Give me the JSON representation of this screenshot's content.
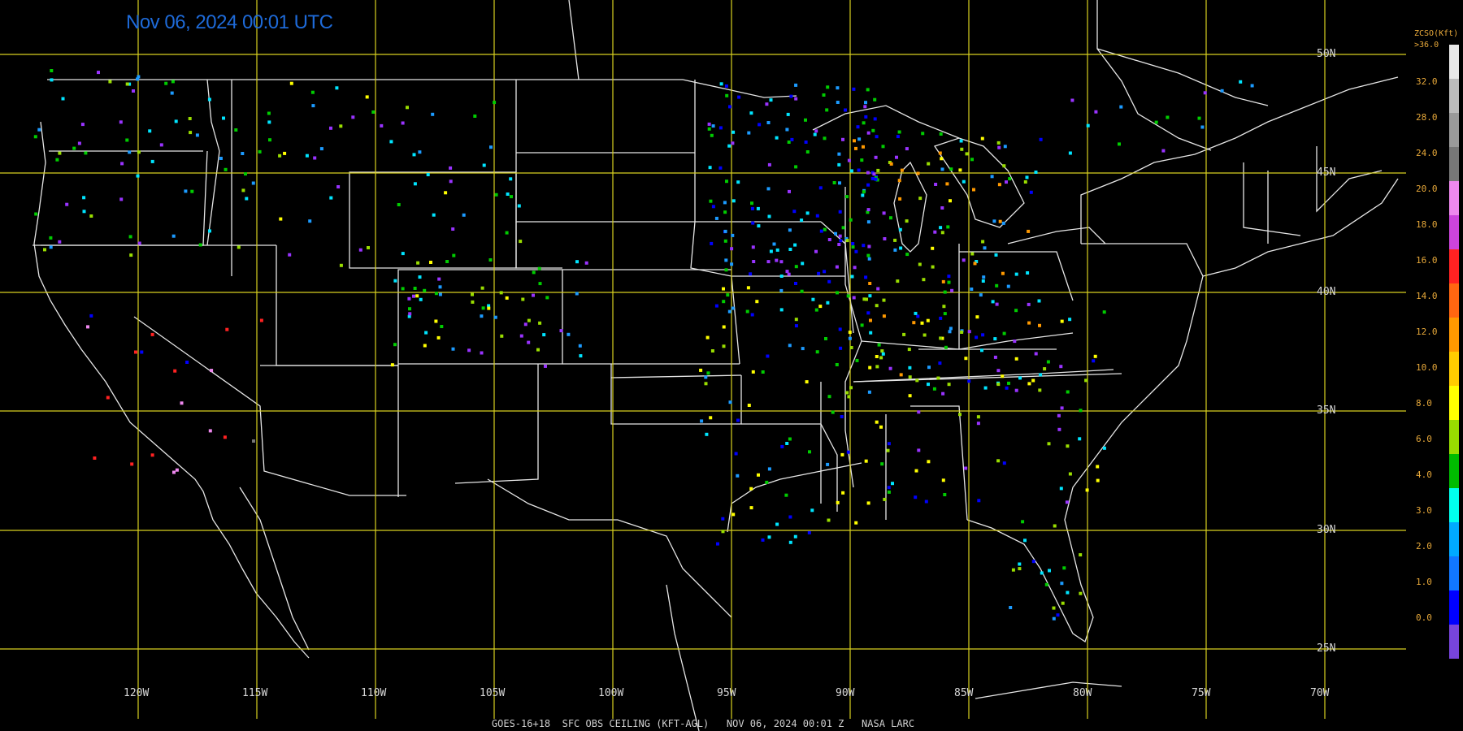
{
  "header": {
    "timestamp": "Nov 06, 2024 00:01 UTC"
  },
  "footer": {
    "caption": "GOES-16+18  SFC OBS CEILING (KFT-AGL)   NOV 06, 2024 00:01 Z   NASA LARC"
  },
  "legend": {
    "title": "ZCSO(Kft)",
    "top_label": ">36.0",
    "labels": [
      "32.0",
      "28.0",
      "24.0",
      "20.0",
      "18.0",
      "16.0",
      "14.0",
      "12.0",
      "10.0",
      "8.0",
      "6.0",
      "4.0",
      "3.0",
      "2.0",
      "1.0",
      "0.0"
    ],
    "colors": [
      "#e8e8e8",
      "#bcbcbc",
      "#9a9a9a",
      "#777777",
      "#ee88ee",
      "#cc44dd",
      "#ff2222",
      "#ff6611",
      "#ff9900",
      "#ffcc00",
      "#ffff00",
      "#99dd00",
      "#00bb00",
      "#00ffee",
      "#00aaff",
      "#1177ff",
      "#0000ff",
      "#7744dd"
    ]
  },
  "map": {
    "lat_labels": [
      {
        "lat": "50N"
      },
      {
        "lat": "45N"
      },
      {
        "lat": "40N"
      },
      {
        "lat": "35N"
      },
      {
        "lat": "30N"
      },
      {
        "lat": "25N"
      }
    ],
    "lon_labels": [
      {
        "lon": "120W"
      },
      {
        "lon": "115W"
      },
      {
        "lon": "110W"
      },
      {
        "lon": "105W"
      },
      {
        "lon": "100W"
      },
      {
        "lon": "95W"
      },
      {
        "lon": "90W"
      },
      {
        "lon": "85W"
      },
      {
        "lon": "80W"
      },
      {
        "lon": "75W"
      },
      {
        "lon": "70W"
      }
    ],
    "grid_color": "#d8d020",
    "border_color": "#e6e6e6"
  }
}
